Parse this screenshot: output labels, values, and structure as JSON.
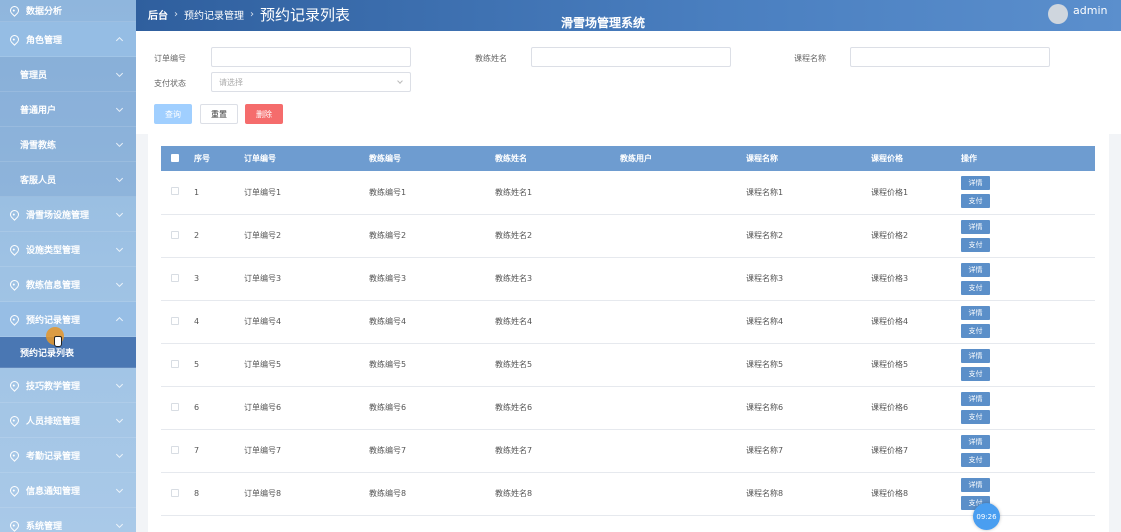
{
  "sidebar": {
    "items": [
      {
        "label": "数据分析",
        "type": "menu",
        "expanded": false
      },
      {
        "label": "角色管理",
        "type": "menu",
        "expanded": true
      },
      {
        "label": "管理员",
        "type": "sub"
      },
      {
        "label": "普通用户",
        "type": "sub"
      },
      {
        "label": "滑雪教练",
        "type": "sub"
      },
      {
        "label": "客服人员",
        "type": "sub"
      },
      {
        "label": "滑雪场设施管理",
        "type": "menu"
      },
      {
        "label": "设施类型管理",
        "type": "menu"
      },
      {
        "label": "教练信息管理",
        "type": "menu"
      },
      {
        "label": "预约记录管理",
        "type": "menu",
        "expanded": true
      },
      {
        "label": "预约记录列表",
        "type": "active-sub"
      },
      {
        "label": "技巧教学管理",
        "type": "menu"
      },
      {
        "label": "人员排班管理",
        "type": "menu"
      },
      {
        "label": "考勤记录管理",
        "type": "menu"
      },
      {
        "label": "信息通知管理",
        "type": "menu"
      },
      {
        "label": "系统管理",
        "type": "menu"
      }
    ]
  },
  "header": {
    "home": "后台",
    "section": "预约记录管理",
    "current": "预约记录列表",
    "system_title": "滑雪场管理系统",
    "user": "admin"
  },
  "search": {
    "order_no_label": "订单编号",
    "coach_name_label": "教练姓名",
    "course_name_label": "课程名称",
    "pay_status_label": "支付状态",
    "pay_status_placeholder": "请选择",
    "order_no_value": "",
    "coach_name_value": "",
    "course_name_value": ""
  },
  "actions": {
    "search": "查询",
    "reset": "重置",
    "delete": "删除"
  },
  "table": {
    "columns": [
      "序号",
      "订单编号",
      "教练编号",
      "教练姓名",
      "教练用户",
      "课程名称",
      "课程价格",
      "操作"
    ],
    "rows": [
      [
        "1",
        "订单编号1",
        "教练编号1",
        "教练姓名1",
        "",
        "课程名称1",
        "课程价格1"
      ],
      [
        "2",
        "订单编号2",
        "教练编号2",
        "教练姓名2",
        "",
        "课程名称2",
        "课程价格2"
      ],
      [
        "3",
        "订单编号3",
        "教练编号3",
        "教练姓名3",
        "",
        "课程名称3",
        "课程价格3"
      ],
      [
        "4",
        "订单编号4",
        "教练编号4",
        "教练姓名4",
        "",
        "课程名称4",
        "课程价格4"
      ],
      [
        "5",
        "订单编号5",
        "教练编号5",
        "教练姓名5",
        "",
        "课程名称5",
        "课程价格5"
      ],
      [
        "6",
        "订单编号6",
        "教练编号6",
        "教练姓名6",
        "",
        "课程名称6",
        "课程价格6"
      ],
      [
        "7",
        "订单编号7",
        "教练编号7",
        "教练姓名7",
        "",
        "课程名称7",
        "课程价格7"
      ],
      [
        "8",
        "订单编号8",
        "教练编号8",
        "教练姓名8",
        "",
        "课程名称8",
        "课程价格8"
      ]
    ],
    "row_actions": {
      "detail": "详情",
      "pay": "支付"
    }
  },
  "clock": "09:26",
  "colors": {
    "sidebar": "#9ec2e4",
    "header": "#3a6cae",
    "table_header": "#6e9cd0",
    "action_button": "#5b8fc9",
    "delete_button": "#f56c6c",
    "search_button": "#a0cfff"
  }
}
